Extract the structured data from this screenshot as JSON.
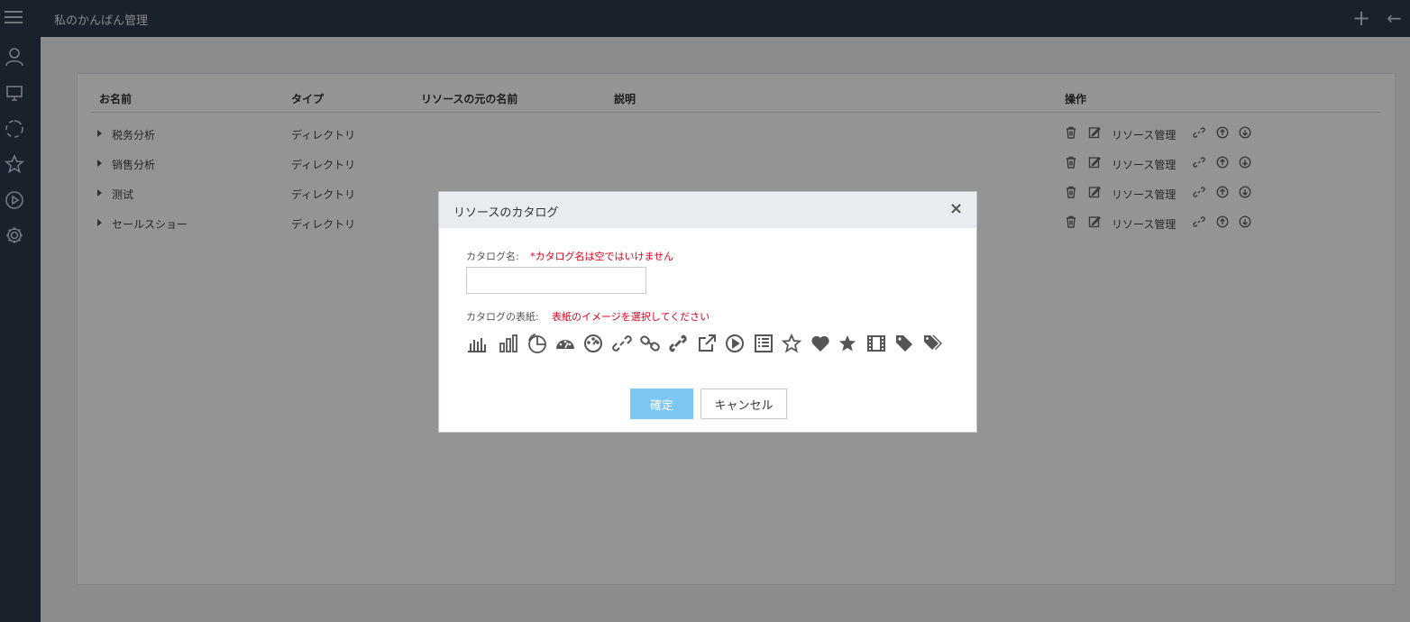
{
  "app": {
    "title": "私のかんばん管理"
  },
  "topbar": {
    "menu_icon": "menu-icon",
    "add_icon": "plus-icon",
    "back_icon": "arrow-left-icon",
    "add_glyph": "+",
    "back_glyph": "←"
  },
  "sidebar": {
    "items": [
      {
        "icon": "user-icon"
      },
      {
        "icon": "monitor-icon"
      },
      {
        "icon": "loading-circle-icon"
      },
      {
        "icon": "star-icon"
      },
      {
        "icon": "play-circle-icon"
      },
      {
        "icon": "gear-icon"
      }
    ]
  },
  "table": {
    "headers": {
      "name": "お名前",
      "type": "タイプ",
      "source": "リソースの元の名前",
      "desc": "説明",
      "ops": "操作"
    },
    "rows": [
      {
        "name": "税务分析",
        "type": "ディレクトリ",
        "manage": "リソース管理"
      },
      {
        "name": "销售分析",
        "type": "ディレクトリ",
        "manage": "リソース管理"
      },
      {
        "name": "测试",
        "type": "ディレクトリ",
        "manage": "リソース管理"
      },
      {
        "name": "セールスショー",
        "type": "ディレクトリ",
        "manage": "リソース管理"
      }
    ],
    "row_op_icons": [
      "trash-icon",
      "edit-icon",
      "link-icon",
      "arrow-up-circle-icon",
      "arrow-down-circle-icon"
    ]
  },
  "modal": {
    "title": "リソースのカタログ",
    "close_glyph": "×",
    "name_label": "カタログ名:",
    "name_error": "*カタログ名は空ではいけません",
    "name_value": "",
    "cover_label": "カタログの表紙:",
    "cover_error": "表紙のイメージを選択してください",
    "cover_icons": [
      "bar-chart-icon",
      "bar-chart-outline-icon",
      "pie-chart-icon",
      "dashboard-icon",
      "gauge-icon",
      "link-icon",
      "chain-icon",
      "link-bold-icon",
      "external-link-icon",
      "play-circle-icon",
      "list-icon",
      "star-outline-icon",
      "heart-icon",
      "star-icon",
      "film-icon",
      "tag-icon",
      "tags-icon"
    ],
    "ok_label": "確定",
    "cancel_label": "キャンセル"
  },
  "colors": {
    "sidebar_bg": "#2b3a4e",
    "ok_button": "#7cc7f3",
    "error_text": "#e0001b"
  }
}
